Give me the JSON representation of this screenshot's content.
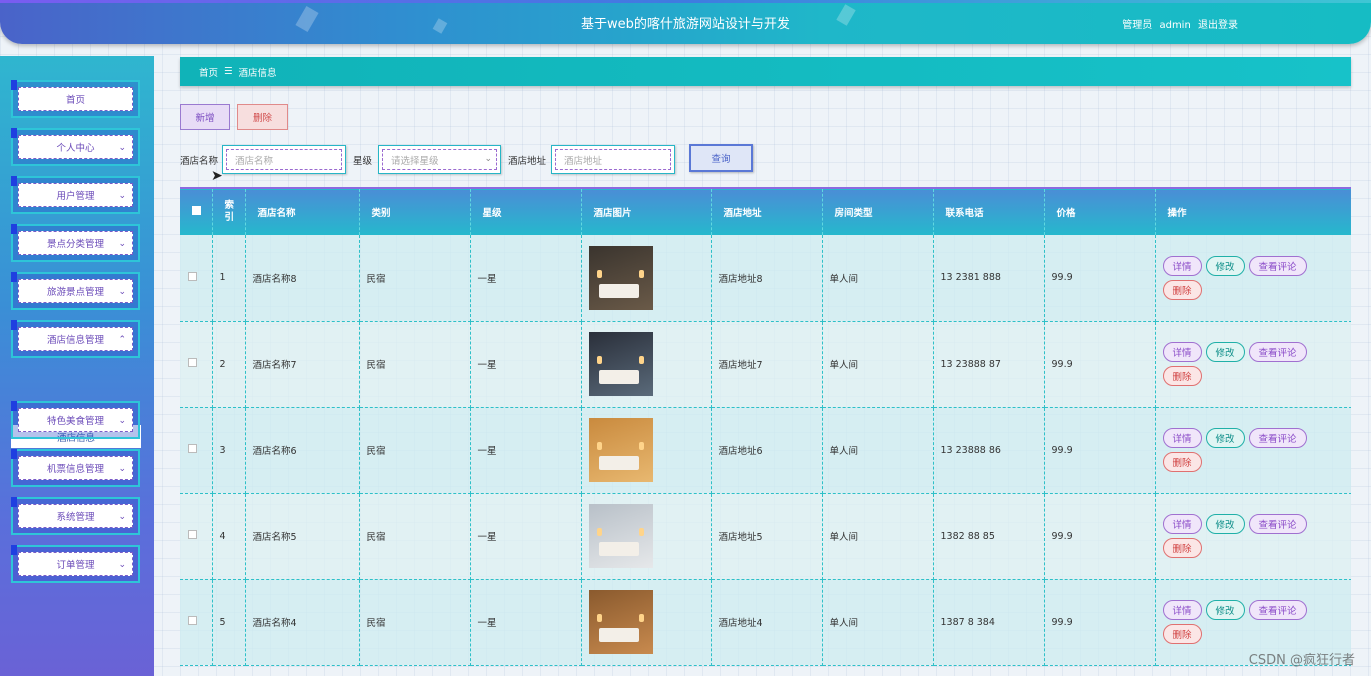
{
  "header": {
    "title": "基于web的喀什旅游网站设计与开发",
    "role_label": "管理员",
    "username": "admin",
    "logout_label": "退出登录"
  },
  "sidebar": {
    "items": [
      {
        "label": "首页",
        "chevron": ""
      },
      {
        "label": "个人中心",
        "chevron": "⌄"
      },
      {
        "label": "用户管理",
        "chevron": "⌄"
      },
      {
        "label": "景点分类管理",
        "chevron": "⌄"
      },
      {
        "label": "旅游景点管理",
        "chevron": "⌄"
      },
      {
        "label": "酒店信息管理",
        "chevron": "⌃"
      },
      {
        "label": "特色美食管理",
        "chevron": "⌄"
      },
      {
        "label": "机票信息管理",
        "chevron": "⌄"
      },
      {
        "label": "系统管理",
        "chevron": "⌄"
      },
      {
        "label": "订单管理",
        "chevron": "⌄"
      }
    ],
    "submenu_active": "酒店信息"
  },
  "breadcrumb": {
    "home": "首页",
    "separator": "☰",
    "current": "酒店信息"
  },
  "actions": {
    "add_label": "新增",
    "delete_label": "删除"
  },
  "search": {
    "name_label": "酒店名称",
    "name_placeholder": "酒店名称",
    "star_label": "星级",
    "star_placeholder": "请选择星级",
    "address_label": "酒店地址",
    "address_placeholder": "酒店地址",
    "query_label": "查询"
  },
  "table": {
    "columns": [
      "索引",
      "酒店名称",
      "类别",
      "星级",
      "酒店图片",
      "酒店地址",
      "房间类型",
      "联系电话",
      "价格",
      "操作"
    ],
    "index_header_lines": [
      "索",
      "引"
    ],
    "op_labels": {
      "detail": "详情",
      "edit": "修改",
      "review": "查看评论",
      "delete": "删除"
    },
    "rows": [
      {
        "index": "1",
        "name": "酒店名称8",
        "category": "民宿",
        "star": "一星",
        "address": "酒店地址8",
        "room_type": "单人间",
        "phone": "13 2381 888",
        "price": "99.9"
      },
      {
        "index": "2",
        "name": "酒店名称7",
        "category": "民宿",
        "star": "一星",
        "address": "酒店地址7",
        "room_type": "单人间",
        "phone": "13 23888 87",
        "price": "99.9"
      },
      {
        "index": "3",
        "name": "酒店名称6",
        "category": "民宿",
        "star": "一星",
        "address": "酒店地址6",
        "room_type": "单人间",
        "phone": "13 23888 86",
        "price": "99.9"
      },
      {
        "index": "4",
        "name": "酒店名称5",
        "category": "民宿",
        "star": "一星",
        "address": "酒店地址5",
        "room_type": "单人间",
        "phone": "1382 88 85",
        "price": "99.9"
      },
      {
        "index": "5",
        "name": "酒店名称4",
        "category": "民宿",
        "star": "一星",
        "address": "酒店地址4",
        "room_type": "单人间",
        "phone": "1387 8 384",
        "price": "99.9"
      }
    ]
  },
  "watermark": "CSDN @疯狂行者",
  "colors": {
    "accent": "#17c2c9",
    "header_start": "#4a63c9",
    "sidebar_end": "#6a62d6"
  }
}
